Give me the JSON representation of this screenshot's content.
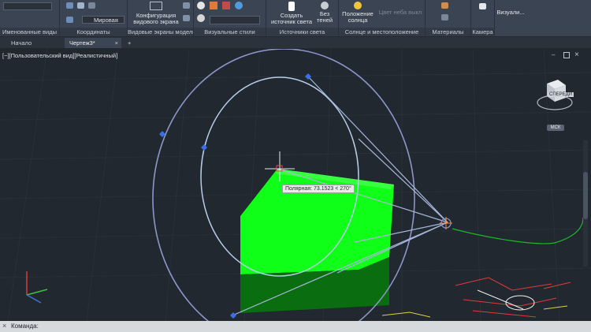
{
  "ribbon": {
    "panels": [
      {
        "label": "Именованные виды"
      },
      {
        "label": "Координаты"
      },
      {
        "label": "Видовые экраны модели"
      },
      {
        "label": "Визуальные стили"
      },
      {
        "label": "Источники света"
      },
      {
        "label": "Солнце и местоположение"
      },
      {
        "label": "Материалы"
      },
      {
        "label": "Камера"
      }
    ],
    "coord_combo_value": "Мировая",
    "viewport_config_label_line1": "Конфигурация",
    "viewport_config_label_line2": "видового экрана",
    "create_light_line1": "Создать",
    "create_light_line2": "источник света",
    "no_shadows_line1": "Без",
    "no_shadows_line2": "теней",
    "sun_status_line1": "Положение",
    "sun_status_line2": "солнца",
    "sky_color_label": "Цвет неба выкл",
    "visualize_label": "Визуали..."
  },
  "tabs": [
    {
      "label": "Начало"
    },
    {
      "label": "Чертеж3*"
    }
  ],
  "viewport": {
    "label": "[−][Пользовательский вид][Реалистичный]",
    "tooltip": "Полярная: 73.1523 < 270°",
    "viewcube_face": "СПЕРЕДИ",
    "wcs_label": "МСК"
  },
  "commandline": {
    "prompt": "Команда:"
  },
  "colors": {
    "ribbon_bg": "#3b4452",
    "viewport_bg": "#212830",
    "solid_green": "#10ff18",
    "light_glyph": "#7f8fc8"
  }
}
